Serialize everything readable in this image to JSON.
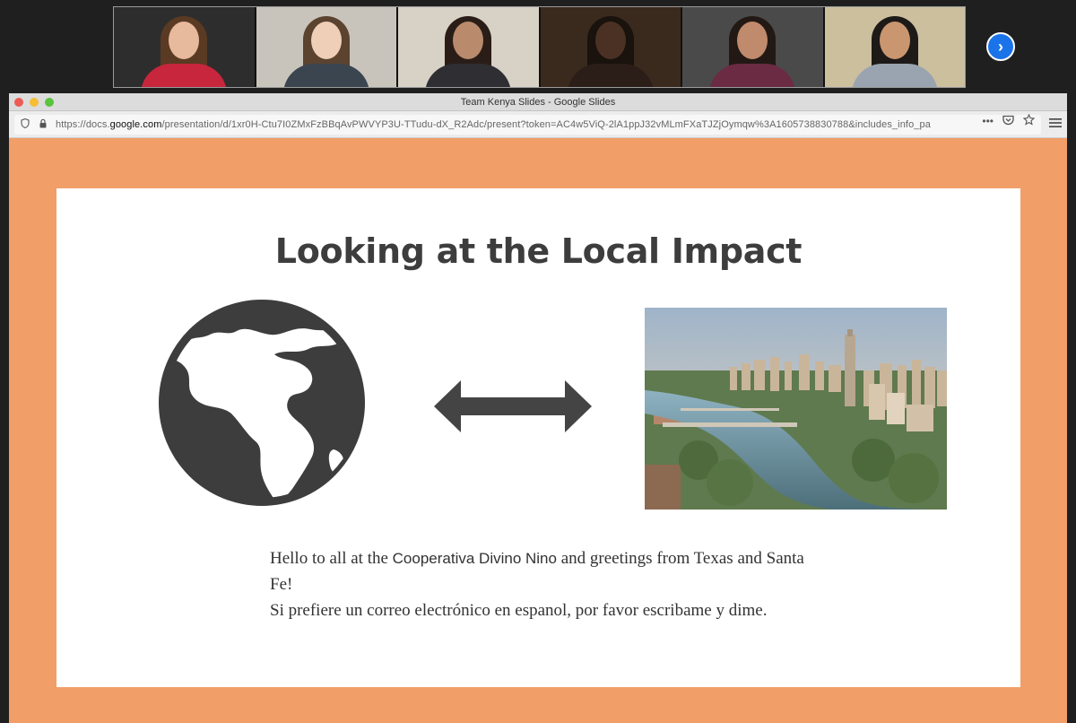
{
  "video": {
    "participants": [
      {
        "name": "participant-1",
        "bg": "#2d2d2d",
        "skin": "#e7b99d",
        "hair": "#5a3a22",
        "shirt": "#c7263d"
      },
      {
        "name": "participant-2",
        "bg": "#c9c4bb",
        "skin": "#efcfb7",
        "hair": "#5b4330",
        "shirt": "#3b4550"
      },
      {
        "name": "participant-3",
        "bg": "#d8d1c6",
        "skin": "#b98a6c",
        "hair": "#2a1d17",
        "shirt": "#2f2f33"
      },
      {
        "name": "participant-4",
        "bg": "#3a2a1e",
        "skin": "#4b3124",
        "hair": "#1a120d",
        "shirt": "#2b1e18"
      },
      {
        "name": "participant-5",
        "bg": "#4a4a4a",
        "skin": "#c08a6d",
        "hair": "#231914",
        "shirt": "#6b2b42"
      },
      {
        "name": "participant-6",
        "bg": "#cbbf9e",
        "skin": "#c9966f",
        "hair": "#1d1a18",
        "shirt": "#9aa4b0"
      }
    ],
    "next_icon": "chevron-right-icon"
  },
  "browser": {
    "window_title": "Team Kenya Slides - Google Slides",
    "url_prefix": "https://docs.",
    "url_domain": "google.com",
    "url_rest": "/presentation/d/1xr0H-Ctu7I0ZMxFzBBqAvPWVYP3U-TTudu-dX_R2Adc/present?token=AC4w5ViQ-2lA1ppJ32vMLmFXaTJZjOymqw%3A1605738830788&includes_info_pa",
    "more_glyph": "•••",
    "colors": {
      "slide_bg": "#f19e69",
      "traffic_red": "#ee5b54",
      "traffic_yellow": "#f6bd35",
      "traffic_green": "#5ac33e"
    }
  },
  "slide": {
    "title": "Looking at the Local Impact",
    "text_line1_a": "Hello to all at the ",
    "text_line1_b": "Cooperativa Divino Nino",
    "text_line1_c": " and greetings from Texas and Santa Fe!",
    "text_line2": "Si prefiere un correo electrónico en  espanol, por favor escribame y dime.",
    "globe_icon": "globe-icon",
    "arrow_icon": "double-arrow-icon",
    "image": "austin-skyline-photo"
  }
}
